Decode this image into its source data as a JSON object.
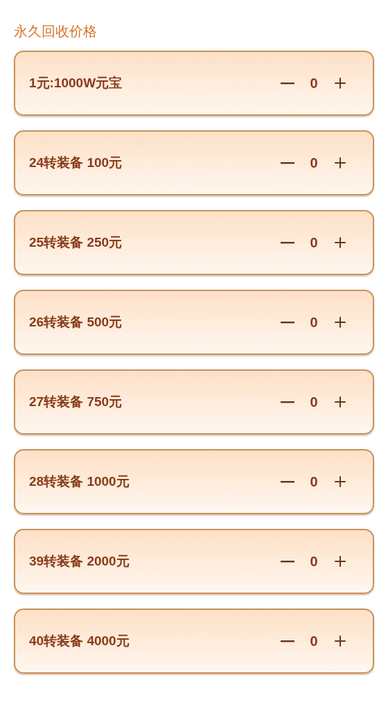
{
  "section": {
    "title": "永久回收价格"
  },
  "items": [
    {
      "label": "1元:1000W元宝",
      "count": "0"
    },
    {
      "label": "24转装备 100元",
      "count": "0"
    },
    {
      "label": "25转装备 250元",
      "count": "0"
    },
    {
      "label": "26转装备 500元",
      "count": "0"
    },
    {
      "label": "27转装备 750元",
      "count": "0"
    },
    {
      "label": "28转装备 1000元",
      "count": "0"
    },
    {
      "label": "39转装备 2000元",
      "count": "0"
    },
    {
      "label": "40转装备 4000元",
      "count": "0"
    }
  ]
}
